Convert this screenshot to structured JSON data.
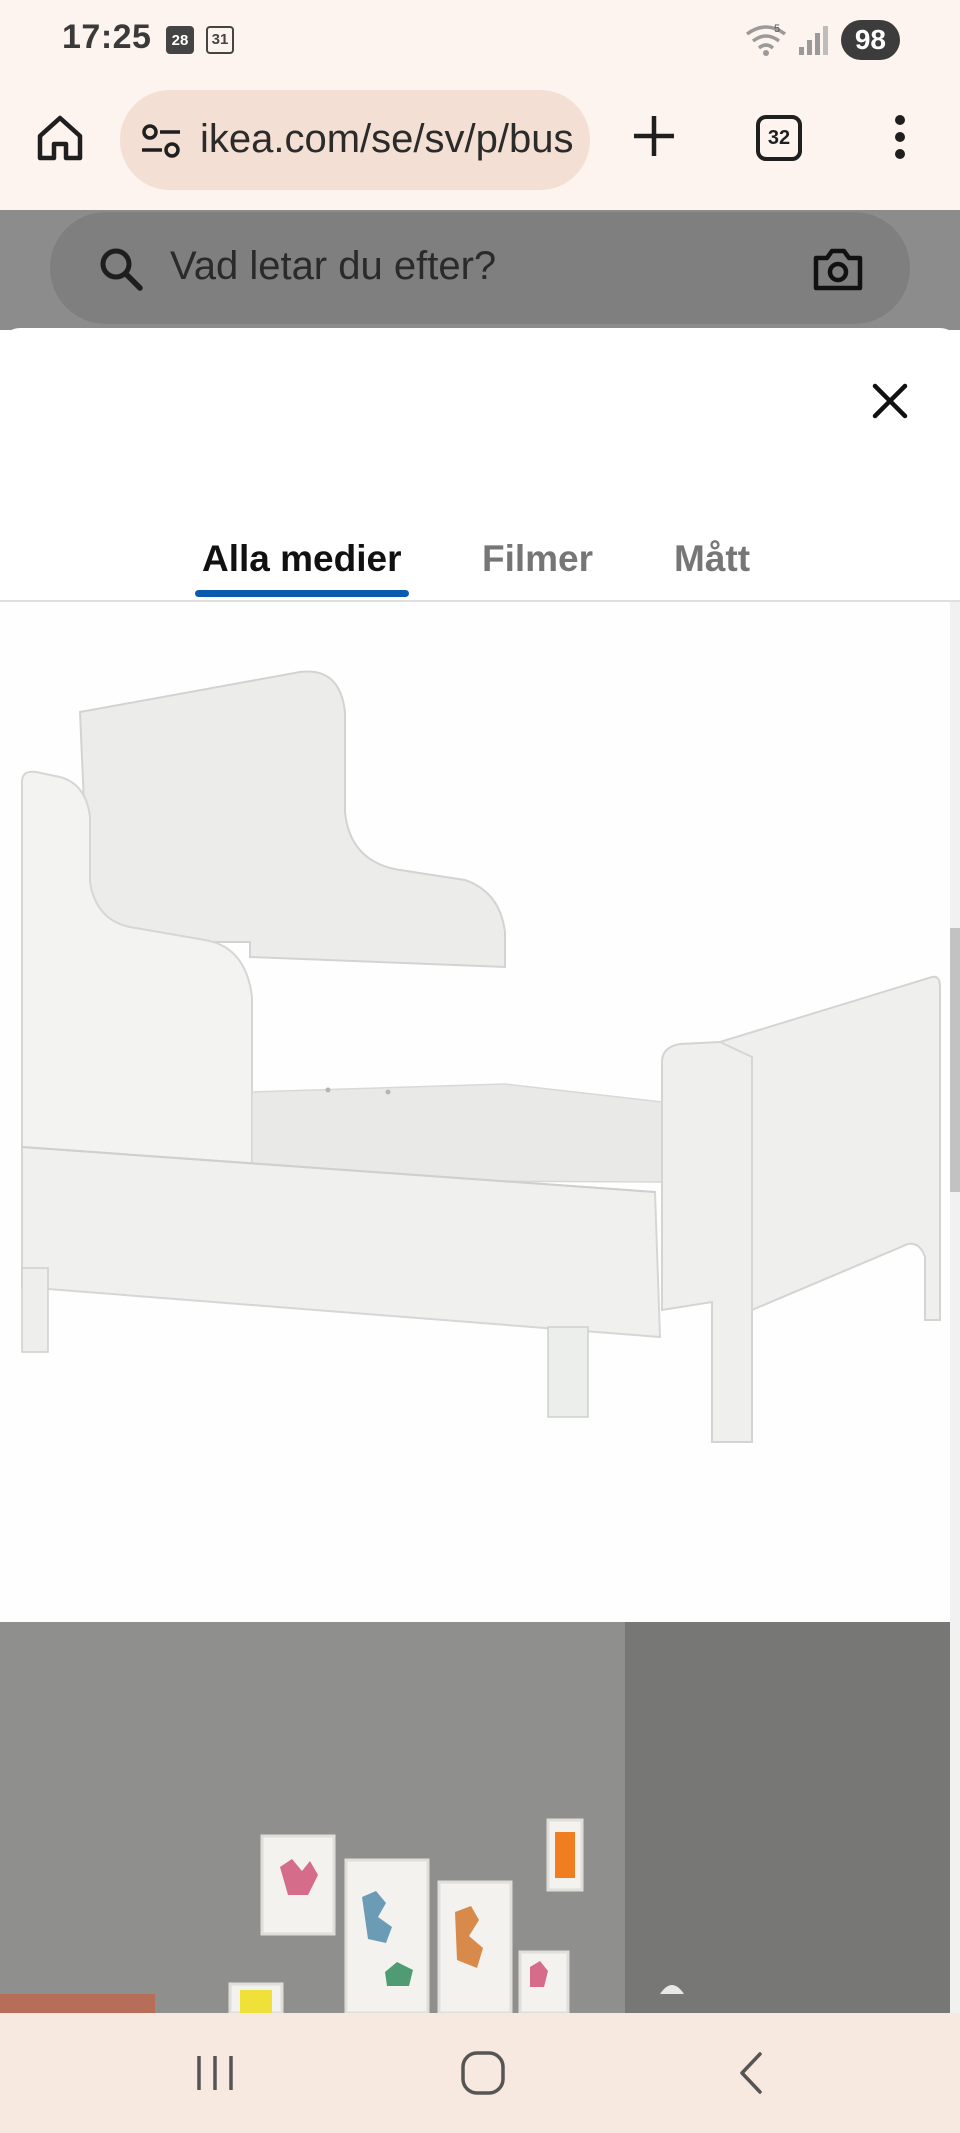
{
  "status_bar": {
    "time": "17:25",
    "calendar_filled": "28",
    "calendar_outline": "31",
    "wifi_label": "5",
    "battery": "98"
  },
  "browser": {
    "url": "ikea.com/se/sv/p/bus",
    "tab_count": "32",
    "icons": {
      "home": "home-icon",
      "site_settings": "tune-icon",
      "new_tab": "plus-icon",
      "menu": "more-vert-icon"
    }
  },
  "page": {
    "search_placeholder": "Vad letar du efter?",
    "icons": {
      "search": "search-icon",
      "camera": "camera-icon"
    }
  },
  "modal": {
    "tabs": [
      {
        "label": "Alla medier",
        "active": true
      },
      {
        "label": "Filmer",
        "active": false
      },
      {
        "label": "Mått",
        "active": false
      }
    ],
    "accent_color": "#0a5ab0",
    "images": [
      "product-bed-image",
      "children-room-image"
    ]
  },
  "nav_bar": {
    "icons": [
      "recent-apps-icon",
      "home-circle-icon",
      "back-icon"
    ]
  }
}
